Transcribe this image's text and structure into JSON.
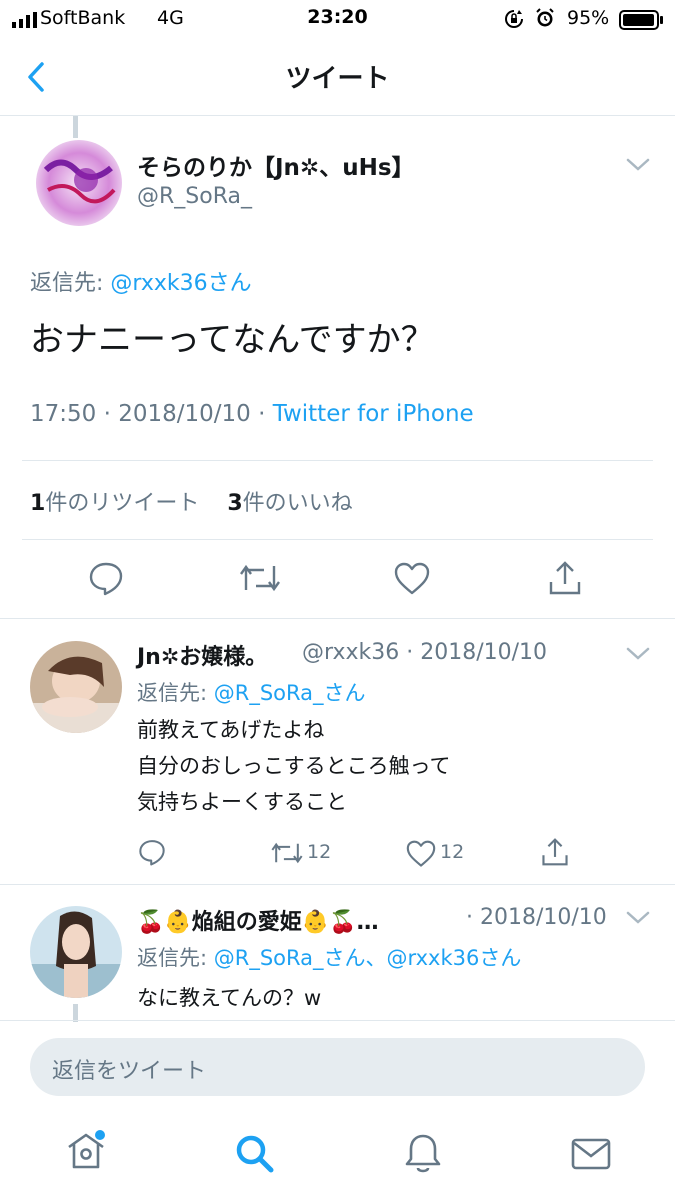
{
  "status": {
    "carrier": "SoftBank",
    "network": "4G",
    "time": "23:20",
    "battery": "95%"
  },
  "nav": {
    "title": "ツイート"
  },
  "main_tweet": {
    "name": "そらのりか【Jn✲、uHs】",
    "handle": "@R_SoRa_",
    "reply_label": "返信先: ",
    "reply_to": "@rxxk36さん",
    "text": "おナニーってなんですか？",
    "time": "17:50 · 2018/10/10 · ",
    "client": "Twitter for iPhone",
    "retweet_count": "1",
    "retweet_label": "件のリツイート",
    "like_count": "3",
    "like_label": "件のいいね"
  },
  "replies": [
    {
      "name": "Jn✲お嬢様。",
      "handle_date": "@rxxk36 · 2018/10/10",
      "reply_label": "返信先: ",
      "reply_to": "@R_SoRa_さん",
      "lines": [
        "前教えてあげたよね",
        "自分のおしっこするところ触って",
        "気持ちよーくすること"
      ],
      "retweets": "12",
      "likes": "12"
    },
    {
      "name": "🍒👶焔組の愛姫👶🍒…",
      "date": "· 2018/10/10",
      "reply_label": "返信先: ",
      "reply_to": "@R_SoRa_さん、@rxxk36さん",
      "text": "なに教えてんの？w"
    }
  ],
  "compose": {
    "placeholder": "返信をツイート"
  },
  "colors": {
    "accent": "#1da1f2",
    "secondary": "#657786",
    "divider": "#e1e8ed"
  },
  "icons": [
    "back-chevron-icon",
    "reply-icon",
    "retweet-icon",
    "like-icon",
    "share-icon",
    "home-icon",
    "search-icon",
    "notifications-icon",
    "messages-icon"
  ]
}
